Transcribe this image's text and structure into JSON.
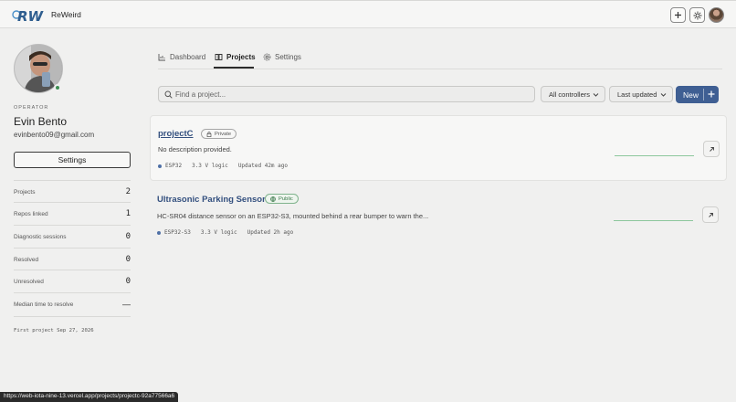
{
  "header": {
    "brand": "ReWeird",
    "icons": {
      "logo": "rw-logo",
      "add": "plus-icon",
      "theme": "sun-icon",
      "avatar": "user-avatar"
    }
  },
  "profile": {
    "role": "OPERATOR",
    "name": "Evin Bento",
    "email": "evinbento09@gmail.com",
    "settings_label": "Settings",
    "stats": [
      {
        "label": "Projects",
        "value": "2"
      },
      {
        "label": "Repos linked",
        "value": "1"
      },
      {
        "label": "Diagnostic sessions",
        "value": "0"
      },
      {
        "label": "Resolved",
        "value": "0"
      },
      {
        "label": "Unresolved",
        "value": "0"
      },
      {
        "label": "Median time to resolve",
        "value": "—"
      }
    ],
    "first_project": "First project Sep 27, 2026"
  },
  "tabs": [
    {
      "label": "Dashboard",
      "icon": "bar-chart-icon"
    },
    {
      "label": "Projects",
      "icon": "book-icon",
      "active": true
    },
    {
      "label": "Settings",
      "icon": "gear-icon"
    }
  ],
  "toolbar": {
    "search_placeholder": "Find a project...",
    "controller_filter": "All controllers",
    "sort": "Last updated",
    "new_label": "New"
  },
  "projects": [
    {
      "name": "projectC",
      "visibility": "Private",
      "visibility_icon": "lock-icon",
      "description": "No description provided.",
      "controller": "ESP32",
      "logic": "3.3 V logic",
      "updated": "Updated 42m ago"
    },
    {
      "name": "Ultrasonic Parking Sensor",
      "visibility": "Public",
      "visibility_icon": "globe-icon",
      "description": "HC-SR04 distance sensor on an ESP32-S3, mounted behind a rear bumper to warn the...",
      "controller": "ESP32-S3",
      "logic": "3.3 V logic",
      "updated": "Updated 2h ago"
    }
  ],
  "status_url": "https://web-iota-nine-13.vercel.app/projects/projectc-92a77566a6",
  "colors": {
    "accent": "#3f5f93",
    "online": "#3e8e52",
    "public": "#3c7a4c"
  }
}
